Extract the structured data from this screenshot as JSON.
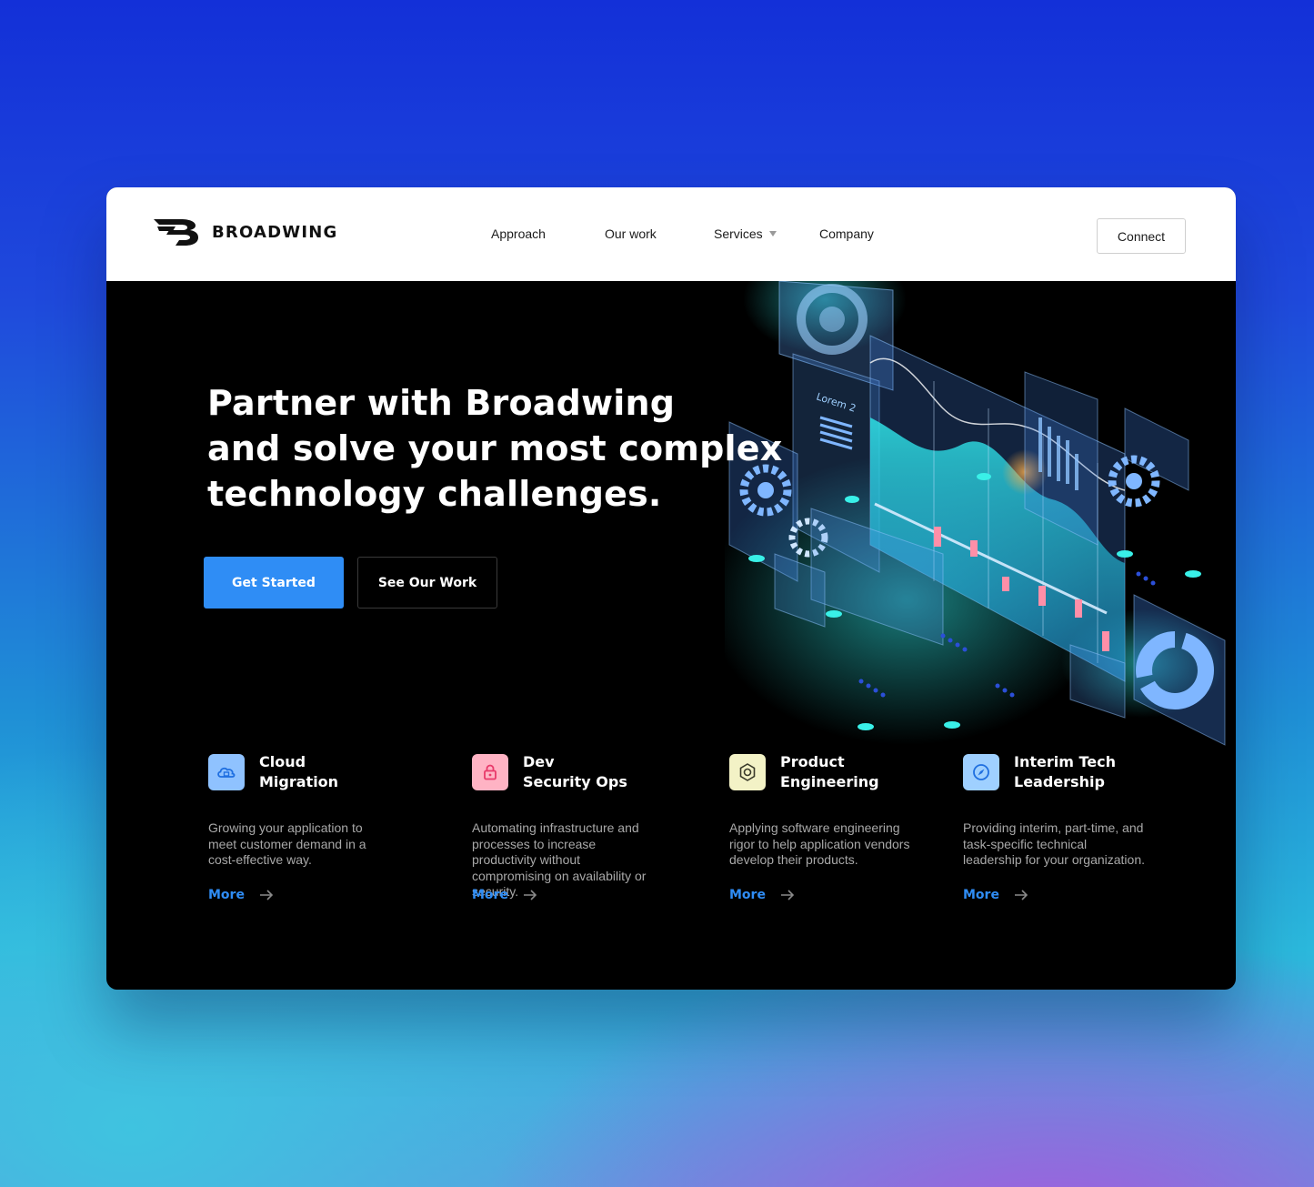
{
  "brand": {
    "name": "BROADWING"
  },
  "nav": {
    "items": [
      "Approach",
      "Our work",
      "Services",
      "Company"
    ],
    "connect_label": "Connect"
  },
  "hero": {
    "headline_lines": [
      "Partner with Broadwing",
      "and solve your most complex",
      "technology challenges."
    ],
    "primary_cta": "Get Started",
    "secondary_cta": "See Our Work",
    "illustration_label": "Lorem 2"
  },
  "services": [
    {
      "title": "Cloud\nMigration",
      "description": "Growing your application to meet customer demand in a cost-effective way.",
      "more": "More",
      "icon": "cloud-icon",
      "icon_bg": "#8fc2ff",
      "icon_color": "#1f6fe0"
    },
    {
      "title": "Dev\nSecurity Ops",
      "description": "Automating infrastructure and processes to increase productivity without compromising on availability or security.",
      "more": "More",
      "icon": "lock-icon",
      "icon_bg": "#ffb3c4",
      "icon_color": "#e8396a"
    },
    {
      "title": "Product\nEngineering",
      "description": "Applying software engineering rigor to help application vendors develop their products.",
      "more": "More",
      "icon": "hexagon-gear-icon",
      "icon_bg": "#f3f2c6",
      "icon_color": "#3a3a2a"
    },
    {
      "title": "Interim Tech\nLeadership",
      "description": "Providing interim, part-time, and task-specific technical leadership for your organization.",
      "more": "More",
      "icon": "compass-icon",
      "icon_bg": "#9fd0ff",
      "icon_color": "#1f6fe0"
    }
  ],
  "colors": {
    "accent": "#2f8df5",
    "background_top": "#1330d8",
    "background_bottom": "#2bb8dc"
  }
}
